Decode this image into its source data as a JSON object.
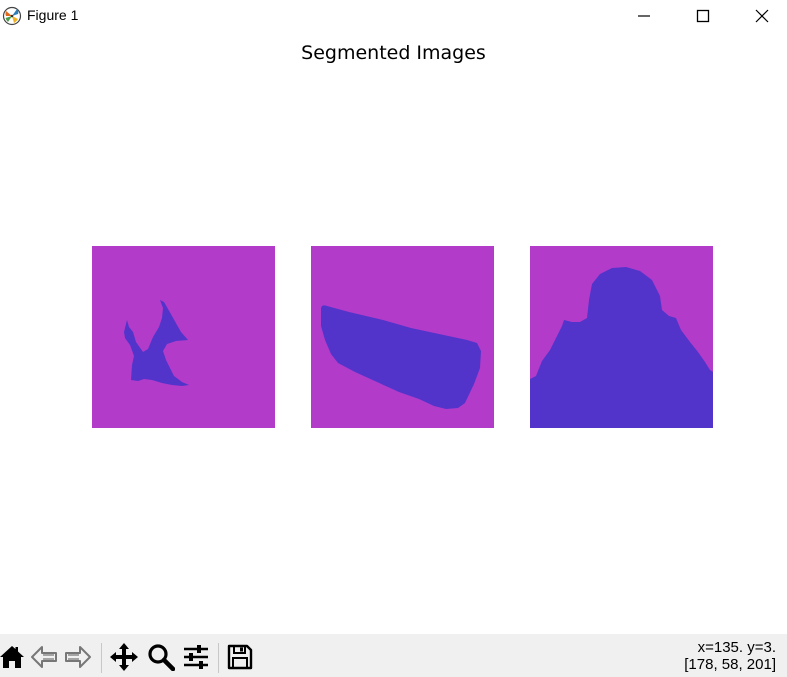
{
  "window": {
    "title": "Figure 1",
    "controls": {
      "minimize_icon": "minimize-icon",
      "maximize_icon": "maximize-icon",
      "close_icon": "close-icon"
    }
  },
  "figure": {
    "suptitle": "Segmented Images",
    "background_color": "#b23bc9",
    "segment_color": "#5234cb",
    "images": [
      {
        "name": "segmented-image-1"
      },
      {
        "name": "segmented-image-2"
      },
      {
        "name": "segmented-image-3"
      }
    ]
  },
  "toolbar": {
    "tools": [
      {
        "icon": "home-icon"
      },
      {
        "icon": "back-arrow-icon"
      },
      {
        "icon": "forward-arrow-icon"
      },
      {
        "icon": "pan-move-icon"
      },
      {
        "icon": "zoom-magnifier-icon"
      },
      {
        "icon": "configure-subplots-icon"
      },
      {
        "icon": "save-disk-icon"
      }
    ],
    "status_line1": "x=135. y=3.",
    "status_line2": "[178, 58, 201]"
  }
}
